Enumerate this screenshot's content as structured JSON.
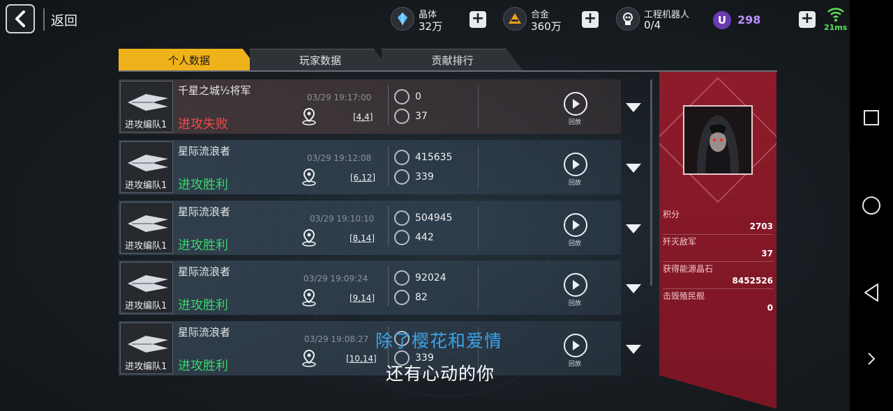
{
  "topbar": {
    "back_label": "返回",
    "resources": [
      {
        "label": "晶体",
        "value": "32万",
        "icon": "crystal-icon"
      },
      {
        "label": "合金",
        "value": "360万",
        "icon": "alloy-icon"
      },
      {
        "label": "工程机器人",
        "value": "0/4",
        "icon": "robot-icon"
      }
    ],
    "premium": {
      "symbol": "U",
      "value": "298"
    },
    "ping": "21ms"
  },
  "tabs": [
    {
      "label": "个人数据",
      "active": true
    },
    {
      "label": "玩家数据",
      "active": false
    },
    {
      "label": "贡献排行",
      "active": false
    }
  ],
  "records": [
    {
      "fleet": "进攻编队1",
      "name": "千星之城½将军",
      "result": "进攻失败",
      "status": "fail",
      "time": "03/29 19:17:00",
      "coord": "[4,4]",
      "stat1": "0",
      "stat2": "37",
      "replay": "回放"
    },
    {
      "fleet": "进攻编队1",
      "name": "星际流浪者",
      "result": "进攻胜利",
      "status": "win",
      "time": "03/29 19:12:08",
      "coord": "[6,12]",
      "stat1": "415635",
      "stat2": "339",
      "replay": "回放"
    },
    {
      "fleet": "进攻编队1",
      "name": "星际流浪者",
      "result": "进攻胜利",
      "status": "win",
      "time": "03/29 19:10:10",
      "coord": "[8,14]",
      "stat1": "504945",
      "stat2": "442",
      "replay": "回放"
    },
    {
      "fleet": "进攻编队1",
      "name": "星际流浪者",
      "result": "进攻胜利",
      "status": "win",
      "time": "03/29 19:09:24",
      "coord": "[9,14]",
      "stat1": "92024",
      "stat2": "82",
      "replay": "回放"
    },
    {
      "fleet": "进攻编队1",
      "name": "星际流浪者",
      "result": "进攻胜利",
      "status": "win",
      "time": "03/29 19:08:27",
      "coord": "[10,14]",
      "stat1": "",
      "stat2": "339",
      "replay": "回放"
    }
  ],
  "side": {
    "stats": [
      {
        "label": "积分",
        "value": "2703"
      },
      {
        "label": "歼灭敌军",
        "value": "37"
      },
      {
        "label": "获得能源晶石",
        "value": "8452526"
      },
      {
        "label": "击毁殖民舰",
        "value": "0"
      }
    ]
  },
  "subtitles": {
    "line1": "除了樱花和爱情",
    "line2": "还有心动的你"
  },
  "colors": {
    "accent": "#f0b21a",
    "win": "#36d66a",
    "fail": "#f0484a",
    "side_panel": "#8e1b2a",
    "premium": "#b990ff"
  }
}
